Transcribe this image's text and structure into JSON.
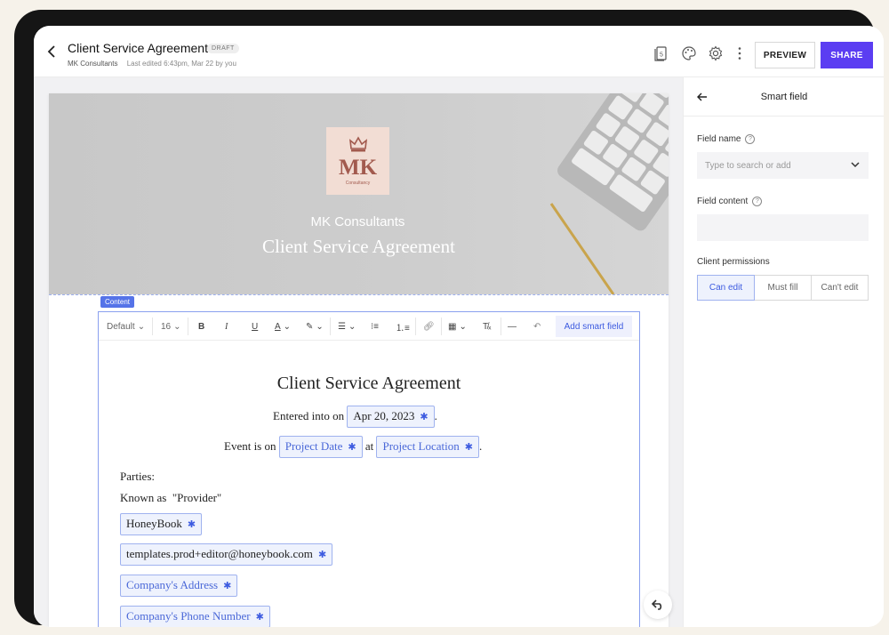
{
  "header": {
    "title": "Client Service Agreement",
    "badge": "DRAFT",
    "company": "MK Consultants",
    "last_edited": "Last edited 6:43pm, Mar 22 by you",
    "preview_label": "PREVIEW",
    "share_label": "SHARE",
    "colors": {
      "share_bg": "#5b3df2"
    }
  },
  "hero": {
    "logo_text": "MK",
    "logo_sub": "Consultancy",
    "company": "MK Consultants",
    "title": "Client Service Agreement"
  },
  "content_tag": "Content",
  "toolbar": {
    "style": "Default",
    "size": "16",
    "add_smart_field": "Add smart field"
  },
  "document": {
    "title": "Client Service Agreement",
    "entered_text": "Entered into on",
    "entered_date": "Apr 20, 2023",
    "event_text": "Event is on",
    "event_date": "Project Date",
    "at_text": "at",
    "event_location": "Project Location",
    "parties": "Parties:",
    "known_as": "Known as  \"Provider\"",
    "fields": {
      "name": "HoneyBook",
      "email": "templates.prod+editor@honeybook.com",
      "address": "Company's Address",
      "phone": "Company's Phone Number"
    }
  },
  "panel": {
    "title": "Smart field",
    "field_name_label": "Field name",
    "field_name_placeholder": "Type to search or add",
    "field_content_label": "Field content",
    "permissions_label": "Client permissions",
    "permissions": [
      "Can edit",
      "Must fill",
      "Can't edit"
    ]
  }
}
